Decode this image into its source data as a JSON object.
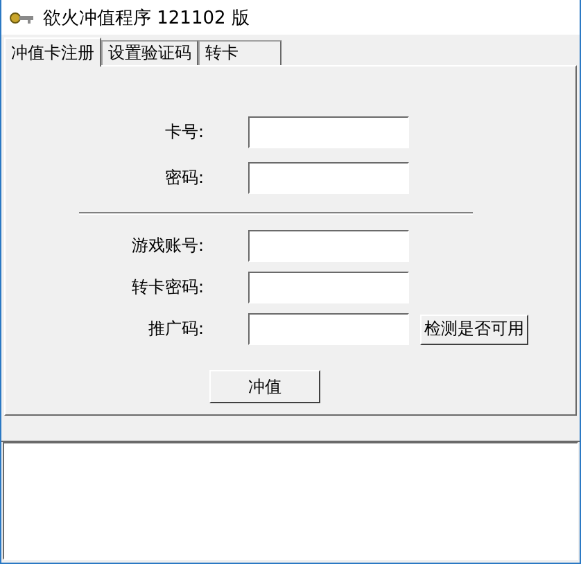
{
  "window": {
    "title": "欲火冲值程序 121102 版"
  },
  "tabs": [
    {
      "label": "冲值卡注册",
      "selected": true
    },
    {
      "label": "设置验证码",
      "selected": false
    },
    {
      "label": "转卡",
      "selected": false
    }
  ],
  "card_fields": [
    {
      "label": "卡号:"
    },
    {
      "label": "密码:"
    }
  ],
  "account_fields": [
    {
      "label": "游戏账号:"
    },
    {
      "label": "转卡密码:"
    },
    {
      "label": "推广码:",
      "button": "检测是否可用"
    }
  ],
  "submit_button": "冲值"
}
